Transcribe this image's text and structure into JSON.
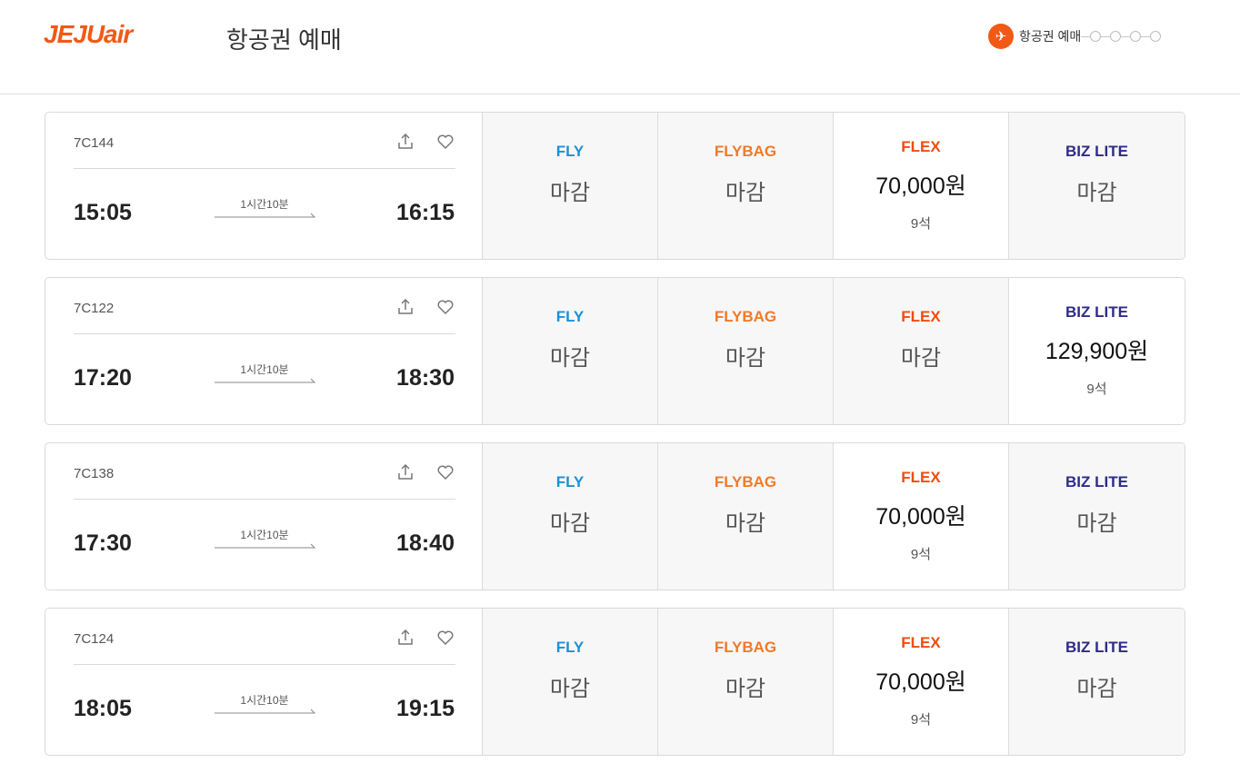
{
  "header": {
    "logo": "JEJUair",
    "title": "항공권 예매",
    "progress_label": "항공권 예매"
  },
  "colors": {
    "brand": "#f05a16",
    "fly": "#1e90d6",
    "flybag": "#f07a2a",
    "flex": "#ee4d0d",
    "biz_lite": "#2e2c8a"
  },
  "icons": {
    "plane": "airplane-icon",
    "share": "share-icon",
    "favorite": "heart-icon"
  },
  "flights": [
    {
      "flight_no": "7C144",
      "departure": "15:05",
      "arrival": "16:15",
      "duration": "1시간10분",
      "fares": {
        "fly": {
          "label": "FLY",
          "status": "마감"
        },
        "flybag": {
          "label": "FLYBAG",
          "status": "마감"
        },
        "flex": {
          "label": "FLEX",
          "price": "70,000원",
          "seats": "9석"
        },
        "biz": {
          "label": "BIZ LITE",
          "status": "마감"
        }
      }
    },
    {
      "flight_no": "7C122",
      "departure": "17:20",
      "arrival": "18:30",
      "duration": "1시간10분",
      "fares": {
        "fly": {
          "label": "FLY",
          "status": "마감"
        },
        "flybag": {
          "label": "FLYBAG",
          "status": "마감"
        },
        "flex": {
          "label": "FLEX",
          "status": "마감"
        },
        "biz": {
          "label": "BIZ LITE",
          "price": "129,900원",
          "seats": "9석"
        }
      }
    },
    {
      "flight_no": "7C138",
      "departure": "17:30",
      "arrival": "18:40",
      "duration": "1시간10분",
      "fares": {
        "fly": {
          "label": "FLY",
          "status": "마감"
        },
        "flybag": {
          "label": "FLYBAG",
          "status": "마감"
        },
        "flex": {
          "label": "FLEX",
          "price": "70,000원",
          "seats": "9석"
        },
        "biz": {
          "label": "BIZ LITE",
          "status": "마감"
        }
      }
    },
    {
      "flight_no": "7C124",
      "departure": "18:05",
      "arrival": "19:15",
      "duration": "1시간10분",
      "fares": {
        "fly": {
          "label": "FLY",
          "status": "마감"
        },
        "flybag": {
          "label": "FLYBAG",
          "status": "마감"
        },
        "flex": {
          "label": "FLEX",
          "price": "70,000원",
          "seats": "9석"
        },
        "biz": {
          "label": "BIZ LITE",
          "status": "마감"
        }
      }
    }
  ]
}
